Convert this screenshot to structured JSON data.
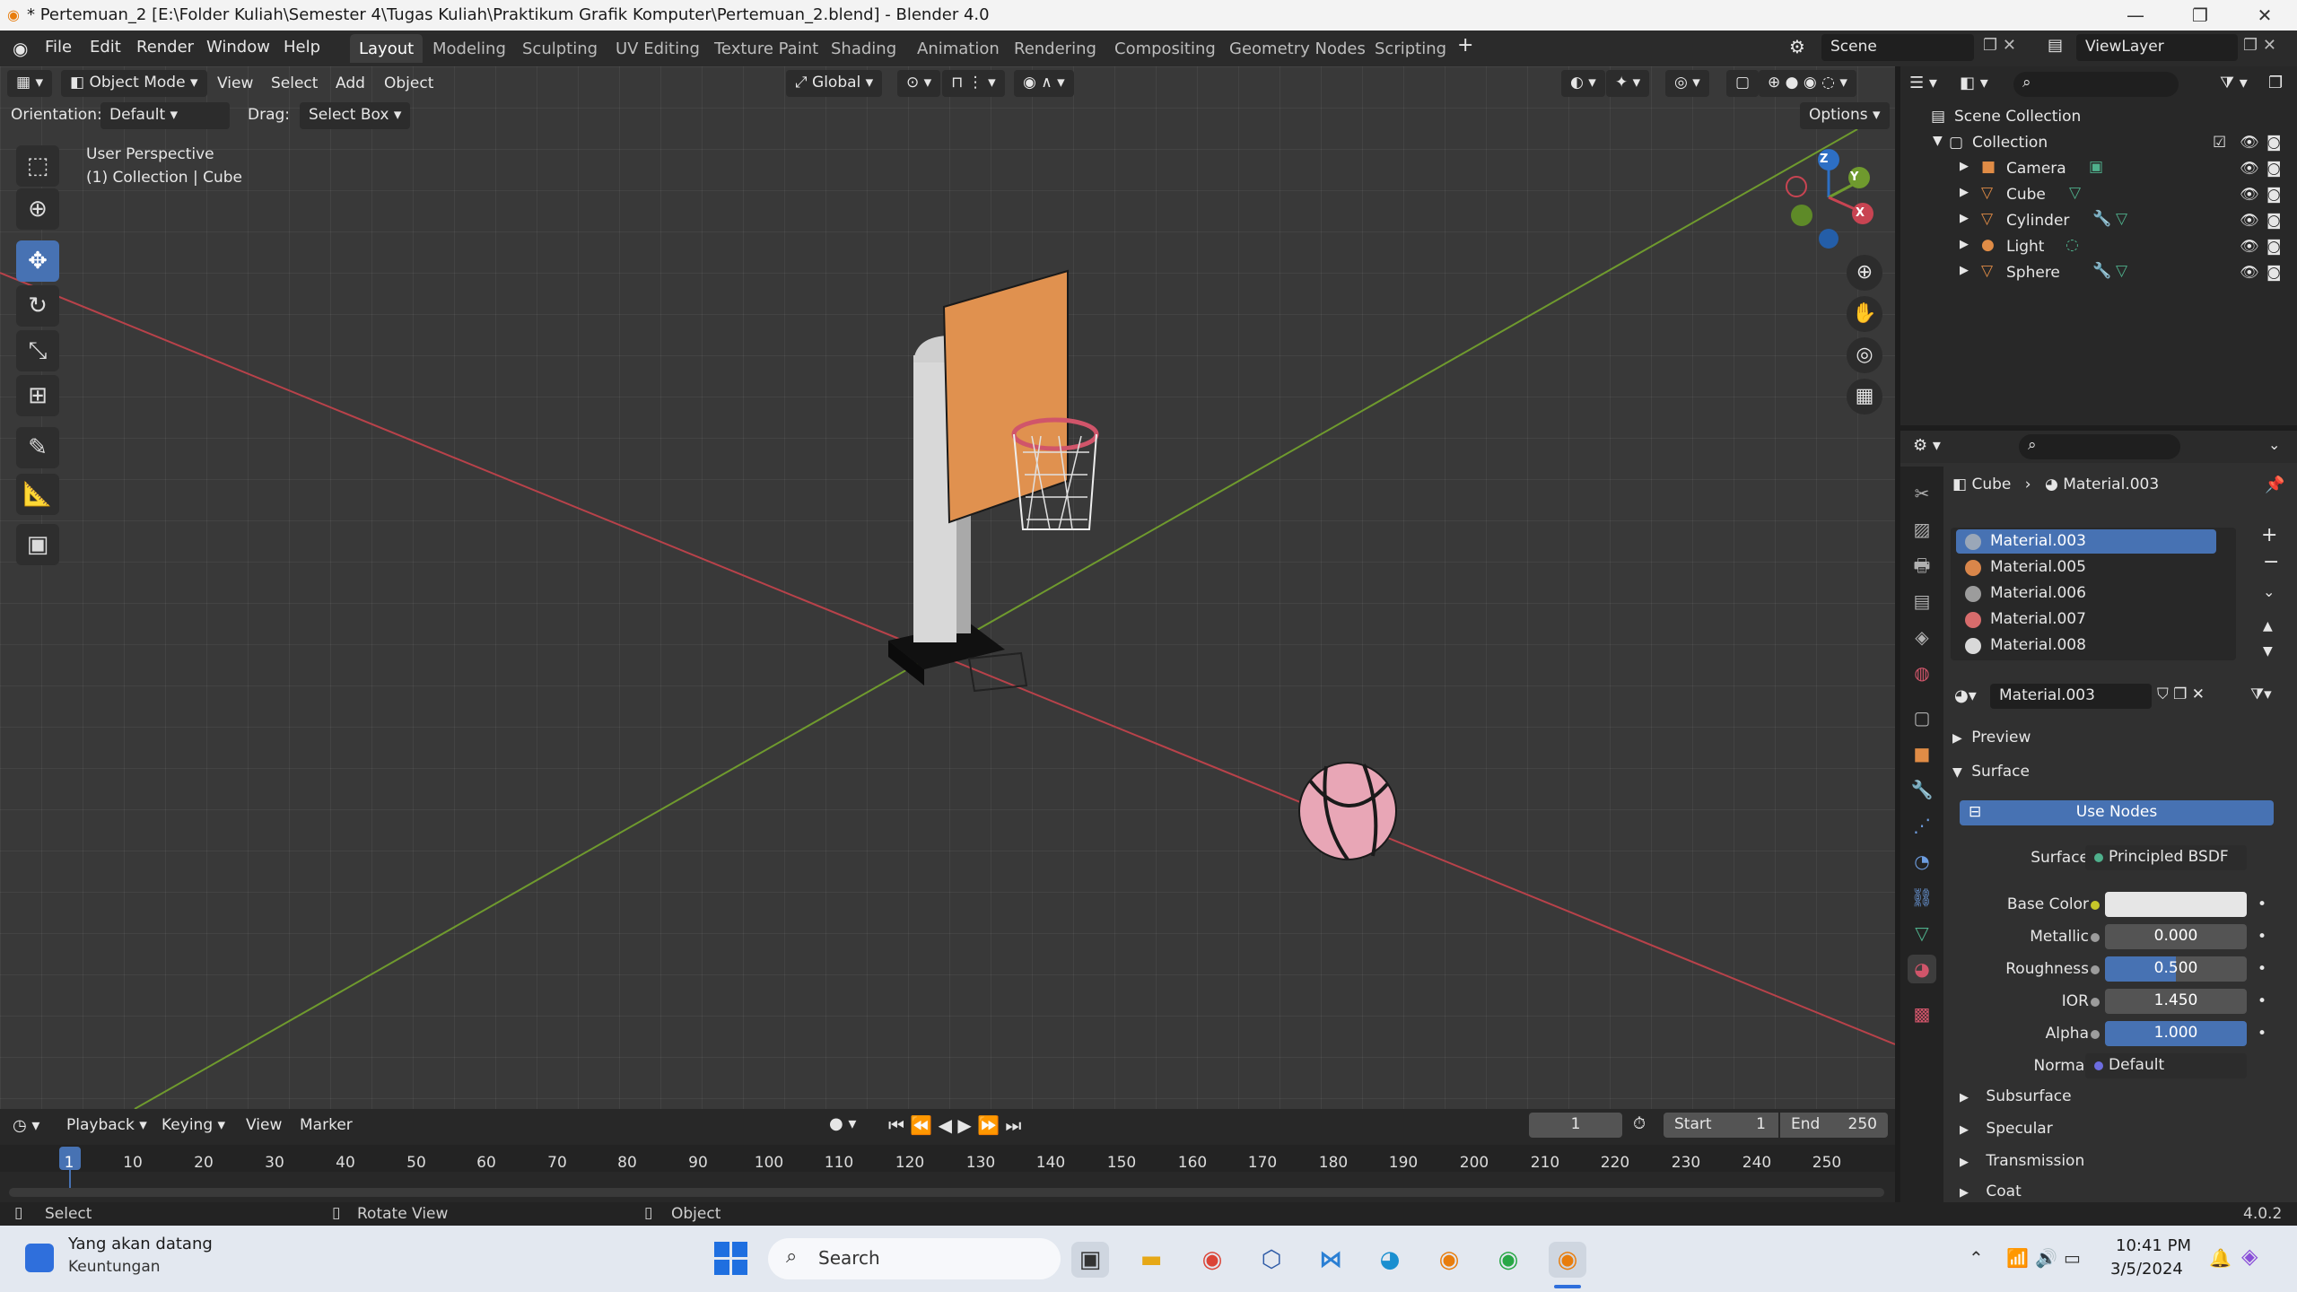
{
  "window": {
    "title": "* Pertemuan_2 [E:\\Folder Kuliah\\Semester 4\\Tugas Kuliah\\Praktikum Grafik Komputer\\Pertemuan_2.blend] - Blender 4.0",
    "minimize": "—",
    "maximize": "❐",
    "close": "✕"
  },
  "menu": [
    "File",
    "Edit",
    "Render",
    "Window",
    "Help"
  ],
  "workspaces": [
    "Layout",
    "Modeling",
    "Sculpting",
    "UV Editing",
    "Texture Paint",
    "Shading",
    "Animation",
    "Rendering",
    "Compositing",
    "Geometry Nodes",
    "Scripting"
  ],
  "scene": {
    "label": "Scene",
    "view_layer": "ViewLayer"
  },
  "viewport_header": {
    "mode": "Object Mode",
    "menus": [
      "View",
      "Select",
      "Add",
      "Object"
    ],
    "transform": "Global",
    "orientation_label": "Orientation:",
    "orientation_value": "Default",
    "drag_label": "Drag:",
    "drag_value": "Select Box",
    "options": "Options"
  },
  "viewport": {
    "perspective": "User Perspective",
    "context": "(1) Collection | Cube",
    "gizmo": {
      "x": "X",
      "y": "Y",
      "z": "Z"
    }
  },
  "outliner": {
    "root": "Scene Collection",
    "collection": "Collection",
    "objects": [
      "Camera",
      "Cube",
      "Cylinder",
      "Light",
      "Sphere"
    ]
  },
  "properties": {
    "object": "Cube",
    "material": "Material.003",
    "materials": [
      {
        "name": "Material.003",
        "color": "#9aa7b8"
      },
      {
        "name": "Material.005",
        "color": "#d9864a"
      },
      {
        "name": "Material.006",
        "color": "#9c9c9c"
      },
      {
        "name": "Material.007",
        "color": "#d86c6c"
      },
      {
        "name": "Material.008",
        "color": "#d9d9d9"
      }
    ],
    "slot_name": "Material.003",
    "preview": "Preview",
    "surface_section": "Surface",
    "use_nodes": "Use Nodes",
    "surface_label": "Surface",
    "surface_value": "Principled BSDF",
    "fields": {
      "base_color_label": "Base Color",
      "metallic_label": "Metallic",
      "metallic": "0.000",
      "roughness_label": "Roughness",
      "roughness": "0.500",
      "ior_label": "IOR",
      "ior": "1.450",
      "alpha_label": "Alpha",
      "alpha": "1.000",
      "normal_label": "Normal",
      "normal": "Default"
    },
    "subsections": [
      "Subsurface",
      "Specular",
      "Transmission",
      "Coat"
    ]
  },
  "timeline": {
    "menus": [
      "Playback",
      "Keying",
      "View",
      "Marker"
    ],
    "current_frame": "1",
    "start_label": "Start",
    "start": "1",
    "end_label": "End",
    "end": "250",
    "ticks": [
      "1",
      "10",
      "20",
      "30",
      "40",
      "50",
      "60",
      "70",
      "80",
      "90",
      "100",
      "110",
      "120",
      "130",
      "140",
      "150",
      "160",
      "170",
      "180",
      "190",
      "200",
      "210",
      "220",
      "230",
      "240",
      "250"
    ]
  },
  "status": {
    "select": "Select",
    "rotate": "Rotate View",
    "object": "Object",
    "version": "4.0.2"
  },
  "taskbar": {
    "weather_title": "Yang akan datang",
    "weather_sub": "Keuntungan",
    "search": "Search",
    "time": "10:41 PM",
    "date": "3/5/2024"
  }
}
